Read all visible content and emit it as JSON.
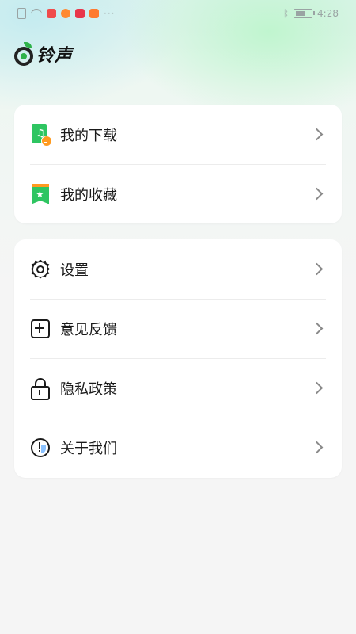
{
  "status_bar": {
    "time": "4:28",
    "more": "···"
  },
  "app": {
    "title": "铃声"
  },
  "menu_group_1": [
    {
      "label": "我的下载",
      "icon": "download-music-icon"
    },
    {
      "label": "我的收藏",
      "icon": "bookmark-star-icon"
    }
  ],
  "menu_group_2": [
    {
      "label": "设置",
      "icon": "gear-icon"
    },
    {
      "label": "意见反馈",
      "icon": "plus-box-icon"
    },
    {
      "label": "隐私政策",
      "icon": "lock-icon"
    },
    {
      "label": "关于我们",
      "icon": "info-icon"
    }
  ],
  "colors": {
    "accent_green": "#2ec561",
    "accent_orange": "#ff9a1f"
  }
}
